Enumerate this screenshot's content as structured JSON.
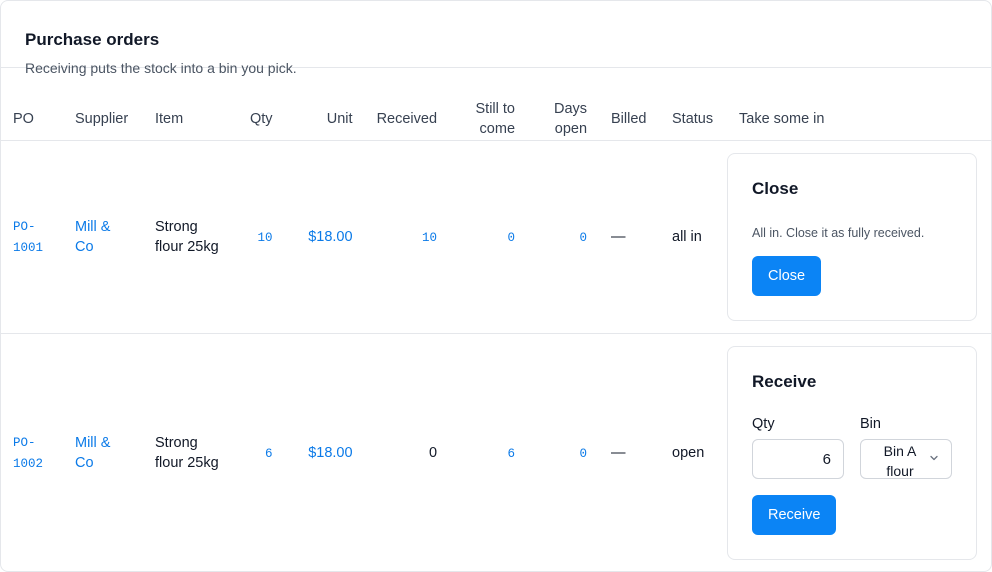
{
  "header": {
    "title": "Purchase orders",
    "subtitle": "Receiving puts the stock into a bin you pick."
  },
  "columns": {
    "po": "PO",
    "supplier": "Supplier",
    "item": "Item",
    "qty": "Qty",
    "unit": "Unit",
    "received": "Received",
    "still_line1": "Still to",
    "still_line2": "come",
    "days_line1": "Days",
    "days_line2": "open",
    "billed": "Billed",
    "status": "Status",
    "take": "Take some in"
  },
  "rows": [
    {
      "po_line1": "PO-",
      "po_line2": "1001",
      "supplier_line1": "Mill &",
      "supplier_line2": "Co",
      "item_line1": "Strong",
      "item_line2": "flour 25kg",
      "qty": "10",
      "unit": "$18.00",
      "received": "10",
      "still": "0",
      "days": "0",
      "billed": "—",
      "status": "all in",
      "action": {
        "title": "Close",
        "hint": "All in. Close it as fully received.",
        "button": "Close"
      }
    },
    {
      "po_line1": "PO-",
      "po_line2": "1002",
      "supplier_line1": "Mill &",
      "supplier_line2": "Co",
      "item_line1": "Strong",
      "item_line2": "flour 25kg",
      "qty": "6",
      "unit": "$18.00",
      "received": "0",
      "still": "6",
      "days": "0",
      "billed": "—",
      "status": "open",
      "action": {
        "title": "Receive",
        "qty_label": "Qty",
        "bin_label": "Bin",
        "qty_value": "6",
        "bin_line1": "Bin A",
        "bin_line2": "flour",
        "button": "Receive"
      }
    }
  ],
  "colors": {
    "link": "#0b7ae8",
    "button": "#0b84f5",
    "border": "#e5e7eb"
  },
  "icons": {
    "select_caret": "chevron-down-icon"
  }
}
